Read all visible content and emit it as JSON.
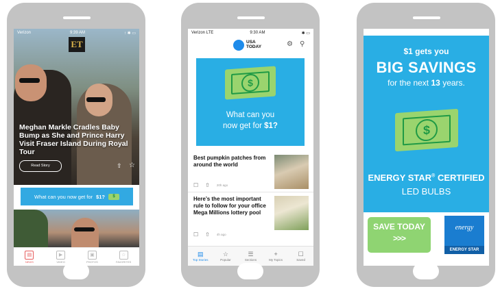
{
  "phone1": {
    "status": {
      "carrier": "Verizon",
      "time": "9:39 AM",
      "right": "↑ ✱ ▭"
    },
    "logo": "ET",
    "headline": "Meghan Markle Cradles Baby Bump as She and Prince Harry Visit Fraser Island During Royal Tour",
    "read_story": "Read Story",
    "banner": {
      "text": "What can you now get for",
      "amount": "$1?",
      "cash": "$"
    },
    "tabs": [
      {
        "label": "NEWS",
        "icon": "▤"
      },
      {
        "label": "VIDEO",
        "icon": "▶"
      },
      {
        "label": "PHOTOS",
        "icon": "▣"
      },
      {
        "label": "FAVORITES",
        "icon": "☆"
      }
    ]
  },
  "phone2": {
    "status": {
      "carrier": "Verizon  LTE",
      "time": "9:30 AM",
      "right": "✱ ▭"
    },
    "brand": "USA TODAY",
    "ad": {
      "line1": "What can you",
      "line2": "now get for",
      "amount": "$1?",
      "cash": "$"
    },
    "articles": [
      {
        "title": "Best pumpkin patches from around the world",
        "time": "20h ago"
      },
      {
        "title": "Here’s the most important rule to follow for your office Mega Millions lottery pool",
        "time": "4h ago"
      }
    ],
    "tabs": [
      {
        "label": "Top Stories",
        "icon": "▤"
      },
      {
        "label": "Popular",
        "icon": "☆"
      },
      {
        "label": "Sections",
        "icon": "☰"
      },
      {
        "label": "My Topics",
        "icon": "+"
      },
      {
        "label": "Saved",
        "icon": "☐"
      }
    ]
  },
  "phone3": {
    "line1": "$1 gets you",
    "line2": "BIG SAVINGS",
    "line3_pre": "for the next",
    "line3_num": "13",
    "line3_post": "years.",
    "cash": "$",
    "energy_line": "ENERGY STAR",
    "energy_reg": "®",
    "energy_tail": "CERTIFIED",
    "bulbs": "LED BULBS",
    "save_today": "SAVE TODAY",
    "save_arrows": ">>>",
    "es_script": "energy",
    "es_label": "ENERGY STAR"
  },
  "colors": {
    "ad_blue": "#29aee4",
    "cash_green": "#9ad46e",
    "save_green": "#8fd472",
    "usa_blue": "#1e8bea",
    "et_red": "#e65b5b"
  }
}
